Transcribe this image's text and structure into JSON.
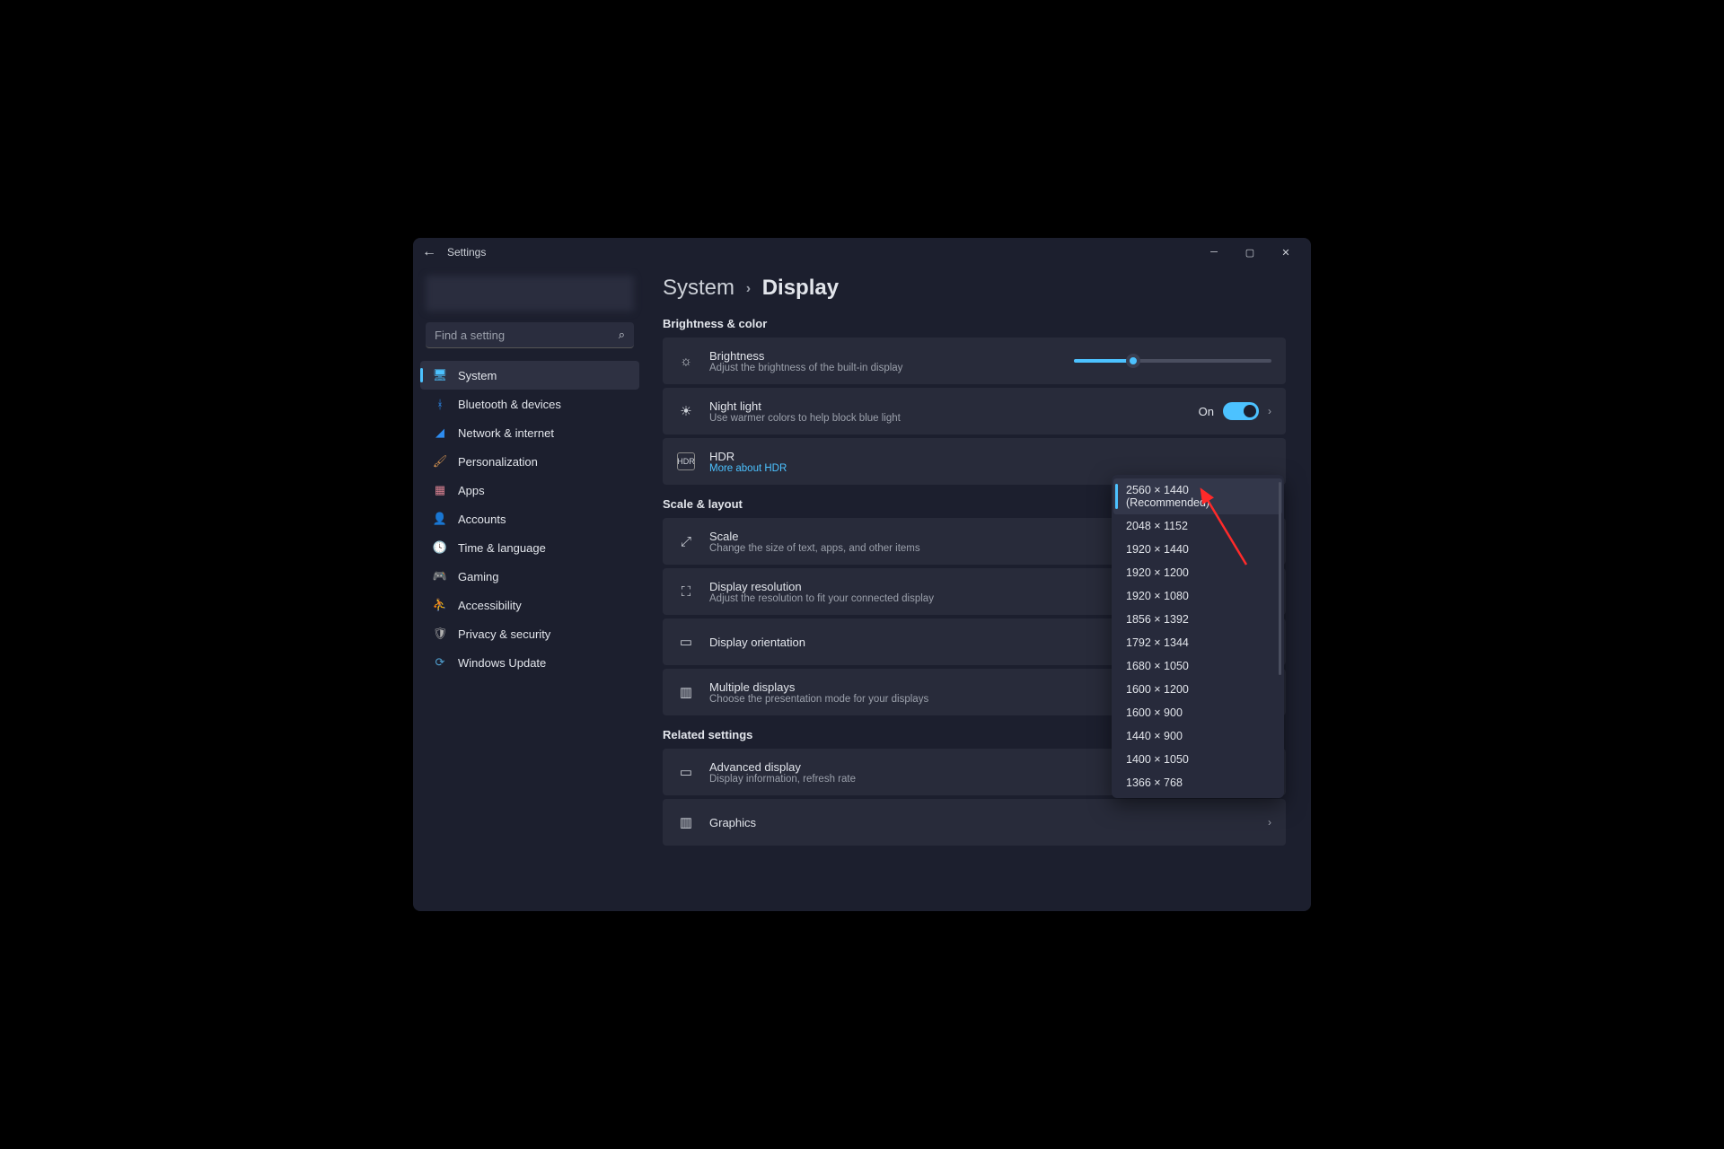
{
  "titlebar": {
    "title": "Settings"
  },
  "search": {
    "placeholder": "Find a setting"
  },
  "nav": [
    {
      "label": "System"
    },
    {
      "label": "Bluetooth & devices"
    },
    {
      "label": "Network & internet"
    },
    {
      "label": "Personalization"
    },
    {
      "label": "Apps"
    },
    {
      "label": "Accounts"
    },
    {
      "label": "Time & language"
    },
    {
      "label": "Gaming"
    },
    {
      "label": "Accessibility"
    },
    {
      "label": "Privacy & security"
    },
    {
      "label": "Windows Update"
    }
  ],
  "breadcrumb": {
    "parent": "System",
    "child": "Display"
  },
  "sections": {
    "brightness_color": "Brightness & color",
    "scale_layout": "Scale & layout",
    "related": "Related settings"
  },
  "cards": {
    "brightness": {
      "title": "Brightness",
      "sub": "Adjust the brightness of the built-in display"
    },
    "nightlight": {
      "title": "Night light",
      "sub": "Use warmer colors to help block blue light",
      "state": "On"
    },
    "hdr": {
      "title": "HDR",
      "sub": "More about HDR"
    },
    "scale": {
      "title": "Scale",
      "sub": "Change the size of text, apps, and other items"
    },
    "resolution": {
      "title": "Display resolution",
      "sub": "Adjust the resolution to fit your connected display"
    },
    "orientation": {
      "title": "Display orientation"
    },
    "multiple": {
      "title": "Multiple displays",
      "sub": "Choose the presentation mode for your displays"
    },
    "advanced": {
      "title": "Advanced display",
      "sub": "Display information, refresh rate"
    },
    "graphics": {
      "title": "Graphics"
    }
  },
  "resolution_options": [
    "2560 × 1440 (Recommended)",
    "2048 × 1152",
    "1920 × 1440",
    "1920 × 1200",
    "1920 × 1080",
    "1856 × 1392",
    "1792 × 1344",
    "1680 × 1050",
    "1600 × 1200",
    "1600 × 900",
    "1440 × 900",
    "1400 × 1050",
    "1366 × 768"
  ]
}
